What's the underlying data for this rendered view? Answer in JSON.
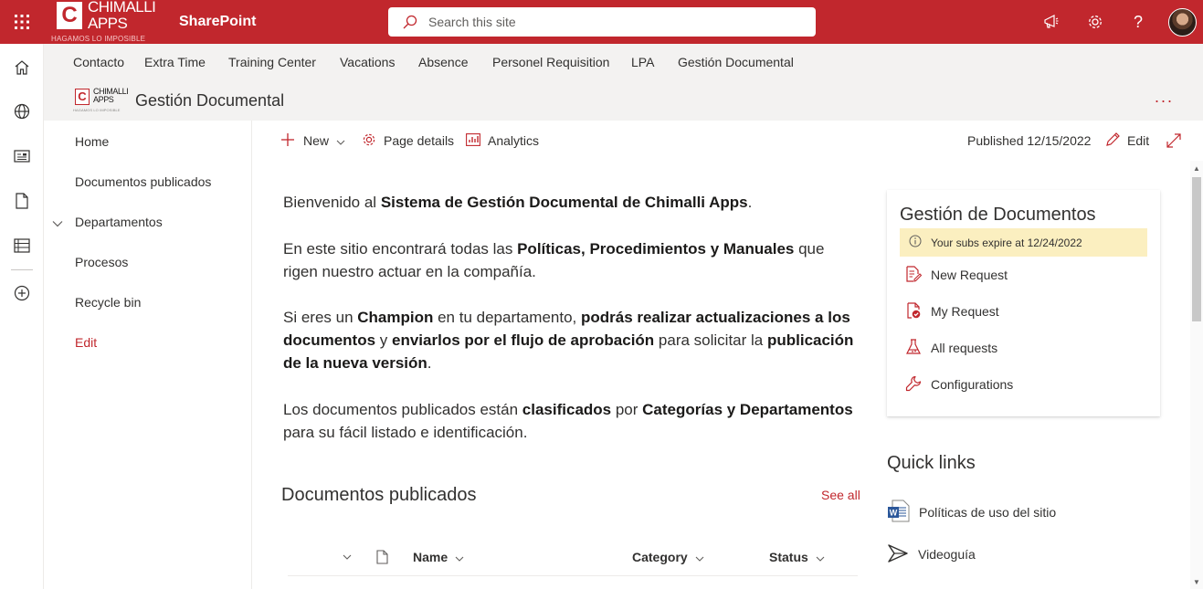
{
  "suite": {
    "brand_line1": "CHIMALLI",
    "brand_line2": "APPS",
    "brand_tagline": "HAGAMOS LO IMPOSIBLE",
    "app_name": "SharePoint",
    "search_placeholder": "Search this site"
  },
  "hubnav": {
    "items": [
      {
        "label": "Contacto"
      },
      {
        "label": "Extra Time"
      },
      {
        "label": "Training Center"
      },
      {
        "label": "Vacations"
      },
      {
        "label": "Absence"
      },
      {
        "label": "Personel Requisition"
      },
      {
        "label": "LPA"
      },
      {
        "label": "Gestión Documental"
      }
    ]
  },
  "site": {
    "logo_line1": "CHIMALLI",
    "logo_line2": "APPS",
    "logo_tagline": "HAGAMOS LO IMPOSIBLE",
    "title": "Gestión Documental"
  },
  "quicklaunch": {
    "items": [
      {
        "label": "Home"
      },
      {
        "label": "Documentos publicados"
      },
      {
        "label": "Departamentos"
      },
      {
        "label": "Procesos"
      },
      {
        "label": "Recycle bin"
      },
      {
        "label": "Edit"
      }
    ]
  },
  "commandbar": {
    "new_label": "New",
    "page_details_label": "Page details",
    "analytics_label": "Analytics",
    "published_label": "Published 12/15/2022",
    "edit_label": "Edit"
  },
  "content": {
    "p1": [
      "Bienvenido al ",
      "Sistema de Gestión Documental de Chimalli Apps",
      "."
    ],
    "p2": [
      "En este sitio encontrará todas las ",
      "Políticas, Procedimientos y Manuales",
      " que rigen nuestro actuar en la compañía."
    ],
    "p3": [
      "Si eres un ",
      "Champion",
      " en tu departamento, ",
      "podrás realizar actualizaciones a los documentos",
      " y ",
      "enviarlos por el flujo de aprobación",
      " para solicitar la ",
      "publicación de la nueva versión",
      "."
    ],
    "p4": [
      "Los documentos publicados están ",
      "clasificados",
      " por ",
      "Categorías y Departamentos",
      " para su fácil listado e identificación."
    ]
  },
  "doclib": {
    "title": "Documentos publicados",
    "see_all": "See all",
    "columns": {
      "name": "Name",
      "category": "Category",
      "status": "Status"
    }
  },
  "card": {
    "title": "Gestión de Documentos",
    "warning": "Your subs expire at 12/24/2022",
    "items": [
      {
        "label": "New Request",
        "icon": "new-request-icon"
      },
      {
        "label": "My Request",
        "icon": "my-request-icon"
      },
      {
        "label": "All requests",
        "icon": "all-requests-icon"
      },
      {
        "label": "Configurations",
        "icon": "wrench-icon"
      }
    ]
  },
  "quicklinks": {
    "title": "Quick links",
    "items": [
      {
        "label": "Políticas de uso del sitio",
        "icon": "word-document-icon"
      },
      {
        "label": "Videoguía",
        "icon": "stream-video-icon"
      }
    ]
  },
  "colors": {
    "brand_red": "#c1272d",
    "warning_bg": "#fbefc0"
  }
}
